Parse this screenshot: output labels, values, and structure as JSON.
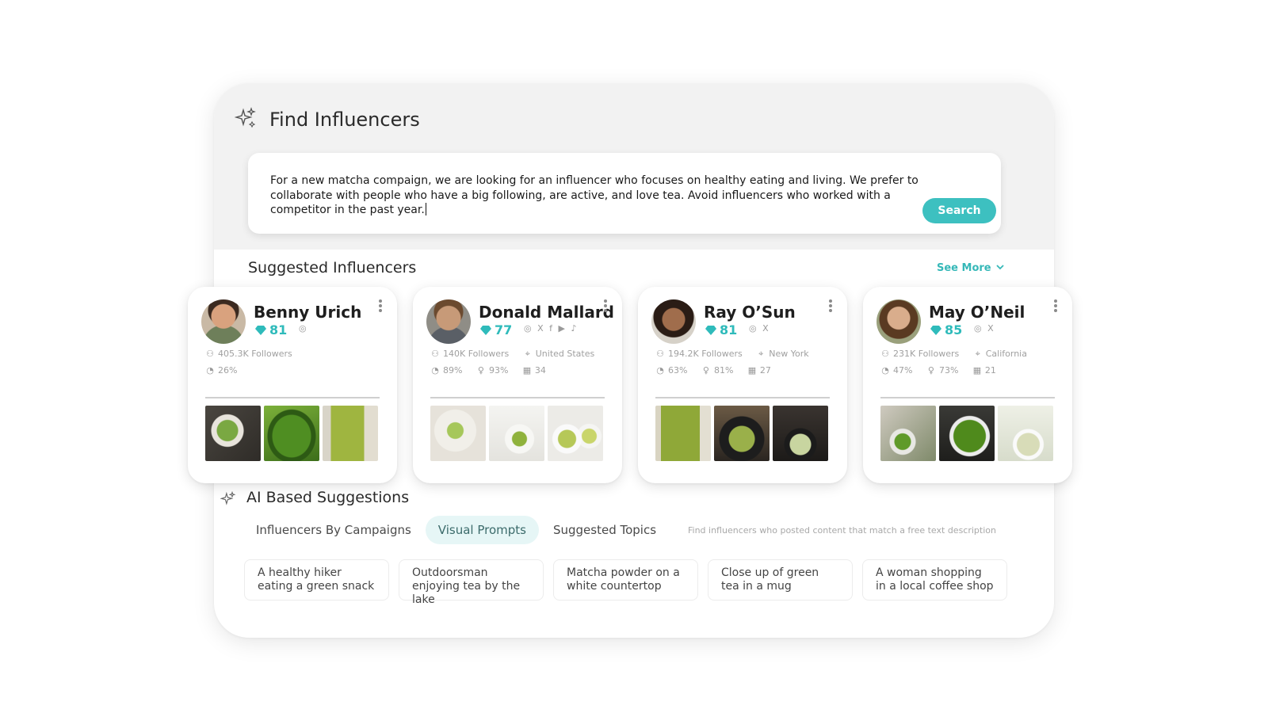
{
  "find": {
    "title": "Find Influencers",
    "prompt": "For a new matcha compaign, we are looking for an influencer who focuses on healthy eating and living. We prefer to collaborate with people who have a big following, are active, and love tea. Avoid influencers who worked with a competitor in the past year.",
    "search_label": "Search"
  },
  "suggested": {
    "title": "Suggested Influencers",
    "see_more": "See More"
  },
  "influencers": [
    {
      "name": "Benny Urich",
      "score": "81",
      "socials": "◎",
      "followers": "405.3K Followers",
      "location": "",
      "stats": [
        "26%"
      ]
    },
    {
      "name": "Donald Mallard",
      "score": "77",
      "socials": "◎ X f ▶ ♪",
      "followers": "140K Followers",
      "location": "United States",
      "stats": [
        "89%",
        "93%",
        "34"
      ]
    },
    {
      "name": "Ray O’Sun",
      "score": "81",
      "socials": "◎ X",
      "followers": "194.2K Followers",
      "location": "New York",
      "stats": [
        "63%",
        "81%",
        "27"
      ]
    },
    {
      "name": "May O’Neil",
      "score": "85",
      "socials": "◎ X",
      "followers": "231K Followers",
      "location": "California",
      "stats": [
        "47%",
        "73%",
        "21"
      ]
    }
  ],
  "ai": {
    "title": "AI Based Suggestions",
    "tabs": [
      "Influencers By Campaigns",
      "Visual Prompts",
      "Suggested Topics"
    ],
    "hint": "Find influencers who posted content that match a free text description",
    "chips": [
      "A healthy hiker eating a green snack",
      "Outdoorsman enjoying tea by the lake",
      "Matcha powder on a white countertop",
      "Close up of green tea in a mug",
      "A woman shopping in a local coffee shop"
    ]
  },
  "colors": {
    "accent": "#3dc0c0",
    "gem": "#2fbbbb",
    "panel_top": "#f2f2f2"
  },
  "icons": [
    "sparkle-icon",
    "followers-icon",
    "location-icon",
    "engagement-icon",
    "gender-icon",
    "age-icon",
    "gem-icon",
    "kebab-menu-icon",
    "chevron-down-icon"
  ]
}
